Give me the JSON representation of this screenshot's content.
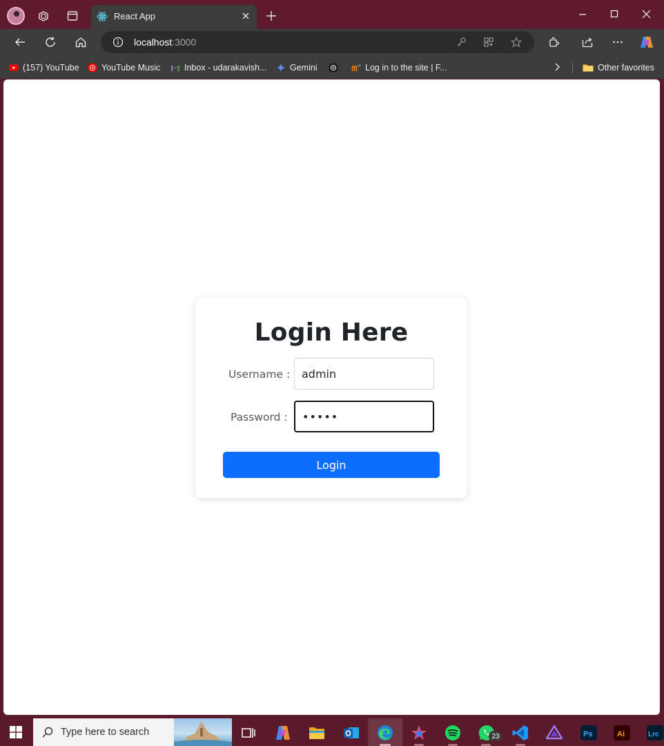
{
  "browser": {
    "tab_title": "React App",
    "address_host": "localhost",
    "address_port": ":3000"
  },
  "bookmarks": [
    {
      "label": "(157) YouTube",
      "icon": "youtube-icon"
    },
    {
      "label": "YouTube Music",
      "icon": "youtube-music-icon"
    },
    {
      "label": "Inbox - udarakavish...",
      "icon": "gmail-icon"
    },
    {
      "label": "Gemini",
      "icon": "gemini-icon"
    },
    {
      "label": "",
      "icon": "chatgpt-icon"
    },
    {
      "label": "Log in to the site | F...",
      "icon": "moodle-icon"
    }
  ],
  "other_favorites": "Other favorites",
  "login": {
    "heading": "Login Here",
    "username_label": "Username :",
    "username_value": "admin",
    "password_label": "Password :",
    "password_value": "•••••",
    "button_label": "Login"
  },
  "taskbar": {
    "search_placeholder": "Type here to search",
    "whatsapp_badge": "23"
  },
  "colors": {
    "accent": "#0d6efd",
    "frame": "#5d1b2d"
  }
}
